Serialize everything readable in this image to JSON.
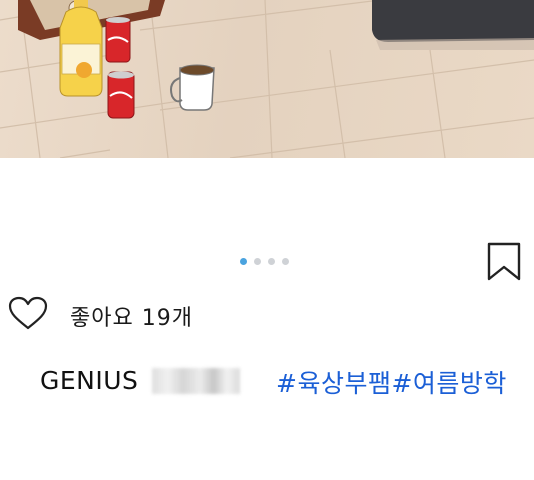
{
  "post": {
    "image": {
      "description_icon": "photo-wood-floor-icon"
    },
    "carousel": {
      "total": 4,
      "active": 1
    },
    "likes_text": "좋아요 19개",
    "caption": {
      "username": "GENIUS",
      "hashtags": "#육상부팸#여름방학"
    }
  },
  "colors": {
    "hashtag": "#1b5fd6",
    "dot_active": "#4aa3df",
    "dot_inactive": "#cfd2d6"
  }
}
